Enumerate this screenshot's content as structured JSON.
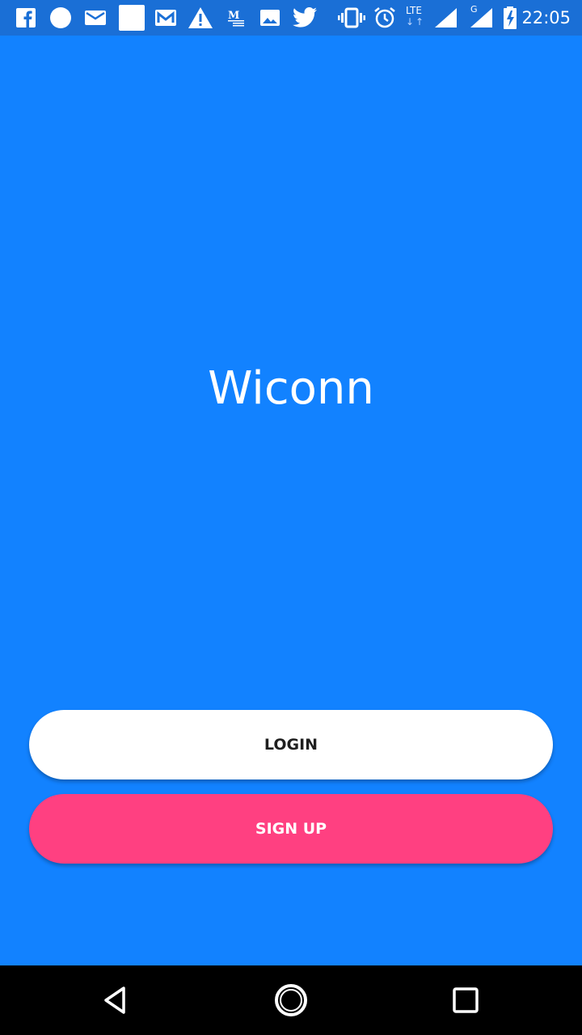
{
  "status_bar": {
    "time": "22:05",
    "network_label": "LTE",
    "network_arrows": "↓↑",
    "secondary_network_label": "G",
    "icons": [
      "facebook-icon",
      "circle-icon",
      "email-icon",
      "blank-square-icon",
      "gmail-icon",
      "warning-icon",
      "medium-icon",
      "image-icon",
      "twitter-icon",
      "vibrate-icon",
      "alarm-icon",
      "signal-icon",
      "signal-icon",
      "battery-charging-icon"
    ]
  },
  "app": {
    "title": "Wiconn",
    "login_label": "LOGIN",
    "signup_label": "SIGN UP"
  },
  "colors": {
    "background": "#1282FF",
    "login_button": "#FFFFFF",
    "signup_button": "#FF4081"
  },
  "nav_bar": {
    "icons": [
      "back-icon",
      "home-icon",
      "recents-icon"
    ]
  }
}
